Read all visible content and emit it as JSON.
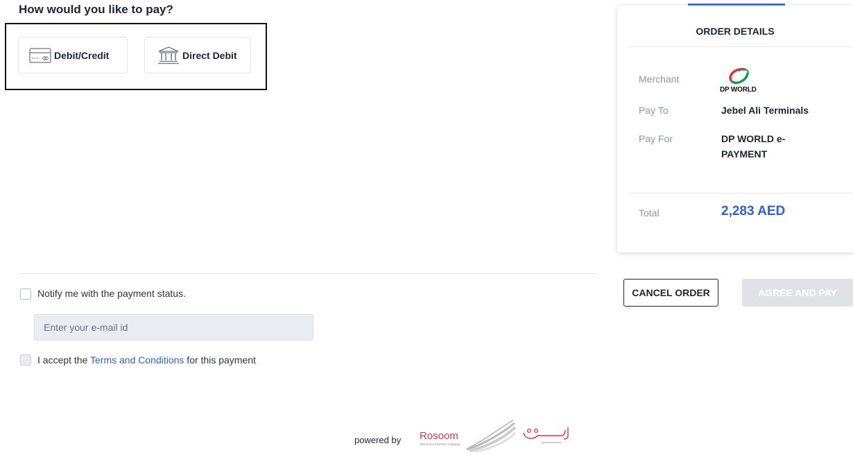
{
  "heading": "How would you like to pay?",
  "payment_methods": [
    {
      "label": "Debit/Credit",
      "icon": "credit-card-icon"
    },
    {
      "label": "Direct Debit",
      "icon": "bank-icon"
    }
  ],
  "notify": {
    "label": "Notify me with the payment status.",
    "checked": false
  },
  "email": {
    "placeholder": "Enter your e-mail id",
    "value": ""
  },
  "terms": {
    "prefix": "I accept the ",
    "link": "Terms and Conditions",
    "suffix": " for this payment",
    "checked": false
  },
  "order": {
    "title": "ORDER DETAILS",
    "merchant_label": "Merchant",
    "merchant_logo_text": "DP WORLD",
    "pay_to_label": "Pay To",
    "pay_to_value": "Jebel Ali Terminals",
    "pay_for_label": "Pay For",
    "pay_for_value": "DP WORLD e-PAYMENT",
    "total_label": "Total",
    "total_value": "2,283 AED"
  },
  "buttons": {
    "cancel": "CANCEL ORDER",
    "pay": "AGREE AND PAY"
  },
  "footer": {
    "powered_by": "powered by",
    "brand": "Rosoom",
    "brand_sub": "Electronic Payment Gateway"
  },
  "colors": {
    "accent": "#2f7fe0",
    "link": "#2b63c9",
    "disabled": "#dfe2e7",
    "rosoom_red": "#d9353d"
  }
}
